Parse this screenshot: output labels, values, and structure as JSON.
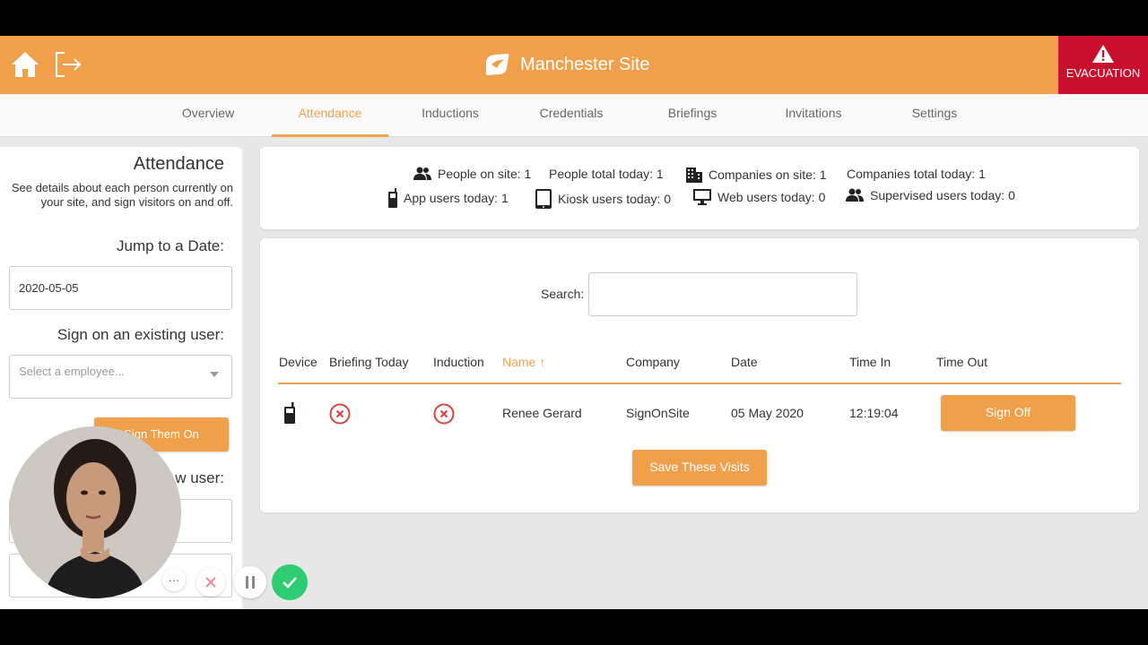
{
  "header": {
    "site_title": "Manchester Site",
    "evacuation_label": "EVACUATION",
    "brand_color": "#f0a04b",
    "evacuation_color": "#c8102e"
  },
  "nav": {
    "tabs": [
      {
        "label": "Overview"
      },
      {
        "label": "Attendance",
        "active": true
      },
      {
        "label": "Inductions"
      },
      {
        "label": "Credentials"
      },
      {
        "label": "Briefings"
      },
      {
        "label": "Invitations"
      },
      {
        "label": "Settings"
      }
    ]
  },
  "sidebar": {
    "title": "Attendance",
    "description": "See details about each person currently on your site, and sign visitors on and off.",
    "jump_label": "Jump to a Date:",
    "date_value": "2020-05-05",
    "existing_user_label": "Sign on an existing user:",
    "employee_placeholder": "Select a employee...",
    "sign_on_button": "Sign Them On",
    "new_user_label_partial": "w user:"
  },
  "stats": {
    "people_on_site": "People on site: 1",
    "people_total_today": "People total today: 1",
    "companies_on_site": "Companies on site: 1",
    "companies_total_today": "Companies total today: 1",
    "app_users_today": "App users today: 1",
    "kiosk_users_today": "Kiosk users today: 0",
    "web_users_today": "Web users today: 0",
    "supervised_users_today": "Supervised users today: 0"
  },
  "table": {
    "search_label": "Search:",
    "headers": {
      "device": "Device",
      "briefing": "Briefing Today",
      "induction": "Induction",
      "name": "Name ↑",
      "company": "Company",
      "date": "Date",
      "time_in": "Time In",
      "time_out": "Time Out"
    },
    "rows": [
      {
        "device": "phone-icon",
        "briefing": "not-complete",
        "induction": "not-complete",
        "name": "Renee Gerard",
        "company": "SignOnSite",
        "date": "05 May 2020",
        "time_in": "12:19:04",
        "action": "Sign Off"
      }
    ],
    "save_button": "Save These Visits"
  },
  "recorder": {
    "more_label": "···",
    "icons": [
      "more-icon",
      "cancel-icon",
      "pause-icon",
      "check-icon"
    ]
  }
}
